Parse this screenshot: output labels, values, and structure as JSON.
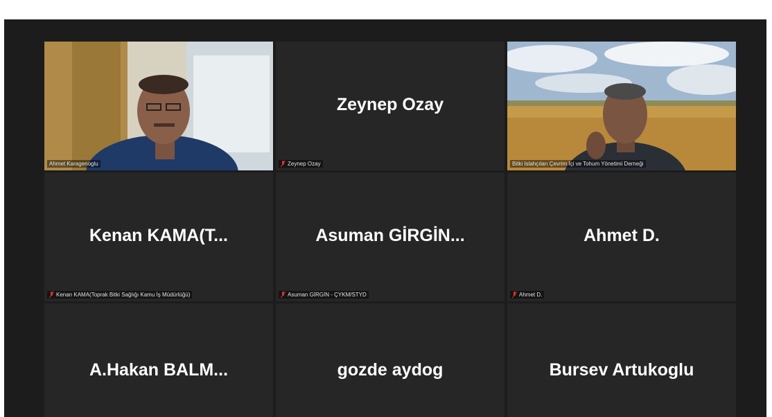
{
  "participants": [
    {
      "name_big": "",
      "label": "Ahmet Karagenoglu",
      "muted": false,
      "video": "man-office"
    },
    {
      "name_big": "Zeynep Ozay",
      "label": "Zeynep Ozay",
      "muted": true,
      "video": null
    },
    {
      "name_big": "",
      "label": "Bitki Islahçıları Çevrim İçi ve Tohum Yönetimi Derneği",
      "muted": false,
      "video": "man-wheatfield"
    },
    {
      "name_big": "Kenan  KAMA(T...",
      "label": "Kenan KAMA(Toprak Bitki Sağlığı Kamu İş Müdürlüğü)",
      "muted": true,
      "video": null
    },
    {
      "name_big": "Asuman  GİRGİN...",
      "label": "Asuman GİRGİN - ÇYKM/STYD",
      "muted": true,
      "video": null
    },
    {
      "name_big": "Ahmet D.",
      "label": "Ahmet D.",
      "muted": true,
      "video": null
    },
    {
      "name_big": "A.Hakan  BALM...",
      "label": "",
      "muted": false,
      "video": null
    },
    {
      "name_big": "gozde aydog",
      "label": "",
      "muted": false,
      "video": null
    },
    {
      "name_big": "Bursev Artukoglu",
      "label": "",
      "muted": false,
      "video": null
    }
  ],
  "colors": {
    "window_bg": "#1c1c1c",
    "tile_bg": "#262626",
    "active_speaker_border": "#cfe07a",
    "muted_icon": "#e0322a"
  }
}
